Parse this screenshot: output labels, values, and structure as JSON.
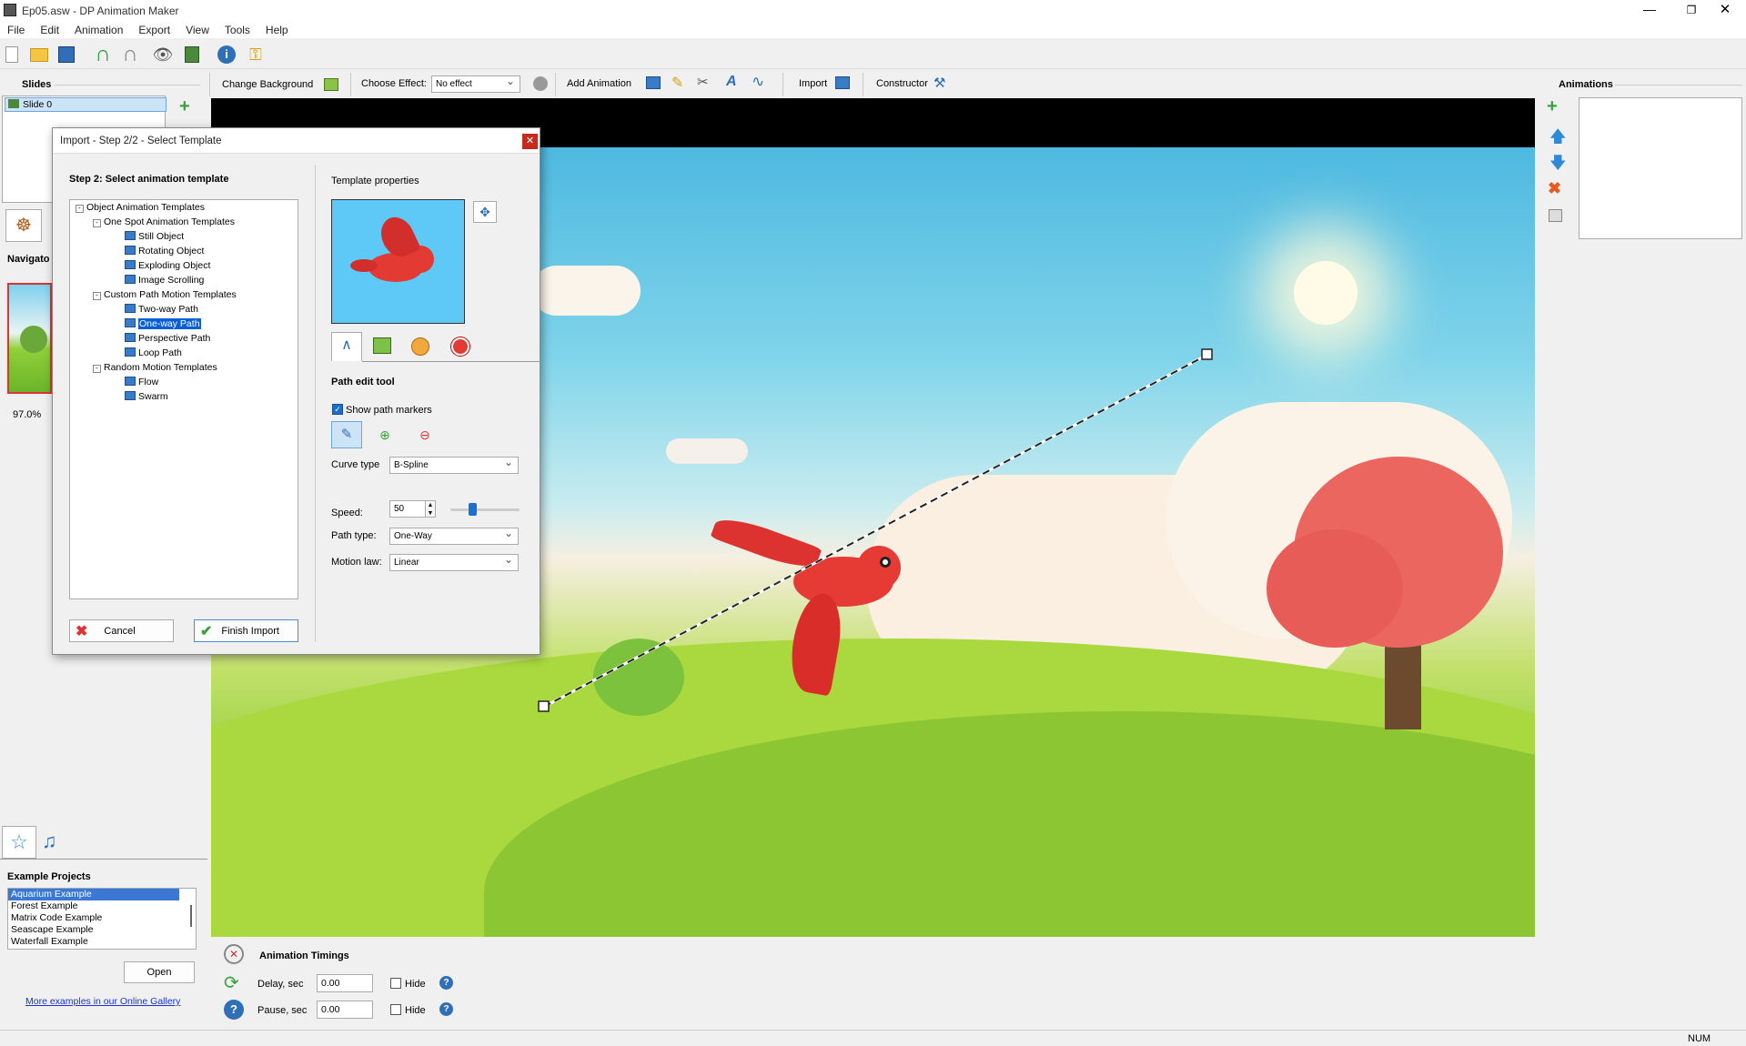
{
  "window": {
    "title": "Ep05.asw - DP Animation Maker"
  },
  "menu": [
    "File",
    "Edit",
    "Animation",
    "Export",
    "View",
    "Tools",
    "Help"
  ],
  "toolbar2": {
    "change_background": "Change Background",
    "choose_effect_label": "Choose Effect:",
    "effect_value": "No effect",
    "add_animation": "Add Animation",
    "import": "Import",
    "constructor": "Constructor"
  },
  "slides": {
    "header": "Slides",
    "items": [
      "Slide 0"
    ]
  },
  "navigator": {
    "label": "Navigato",
    "zoom": "97.0%"
  },
  "animations": {
    "header": "Animations"
  },
  "examples": {
    "header": "Example Projects",
    "items": [
      "Aquarium Example",
      "Forest Example",
      "Matrix Code Example",
      "Seascape Example",
      "Waterfall Example"
    ],
    "open": "Open",
    "gallery_link": "More examples in our Online Gallery"
  },
  "timings": {
    "header": "Animation Timings",
    "delay_label": "Delay, sec",
    "delay_value": "0.00",
    "pause_label": "Pause, sec",
    "pause_value": "0.00",
    "hide": "Hide"
  },
  "status": {
    "num": "NUM"
  },
  "dialog": {
    "title": "Import - Step 2/2 - Select Template",
    "step_label": "Step 2: Select animation template",
    "tree": {
      "root": "Object Animation Templates",
      "group1": "One Spot Animation Templates",
      "g1_items": [
        "Still Object",
        "Rotating Object",
        "Exploding Object",
        "Image Scrolling"
      ],
      "group2": "Custom Path Motion Templates",
      "g2_items": [
        "Two-way Path",
        "One-way Path",
        "Perspective Path",
        "Loop Path"
      ],
      "group3": "Random Motion Templates",
      "g3_items": [
        "Flow",
        "Swarm"
      ]
    },
    "props_label": "Template properties",
    "tool_header": "Path edit tool",
    "show_markers": "Show path markers",
    "curve_label": "Curve type",
    "curve_value": "B-Spline",
    "speed_label": "Speed:",
    "speed_value": "50",
    "speed_fraction": 0.3,
    "path_type_label": "Path type:",
    "path_type_value": "One-Way",
    "motion_label": "Motion law:",
    "motion_value": "Linear",
    "cancel": "Cancel",
    "finish": "Finish Import"
  }
}
